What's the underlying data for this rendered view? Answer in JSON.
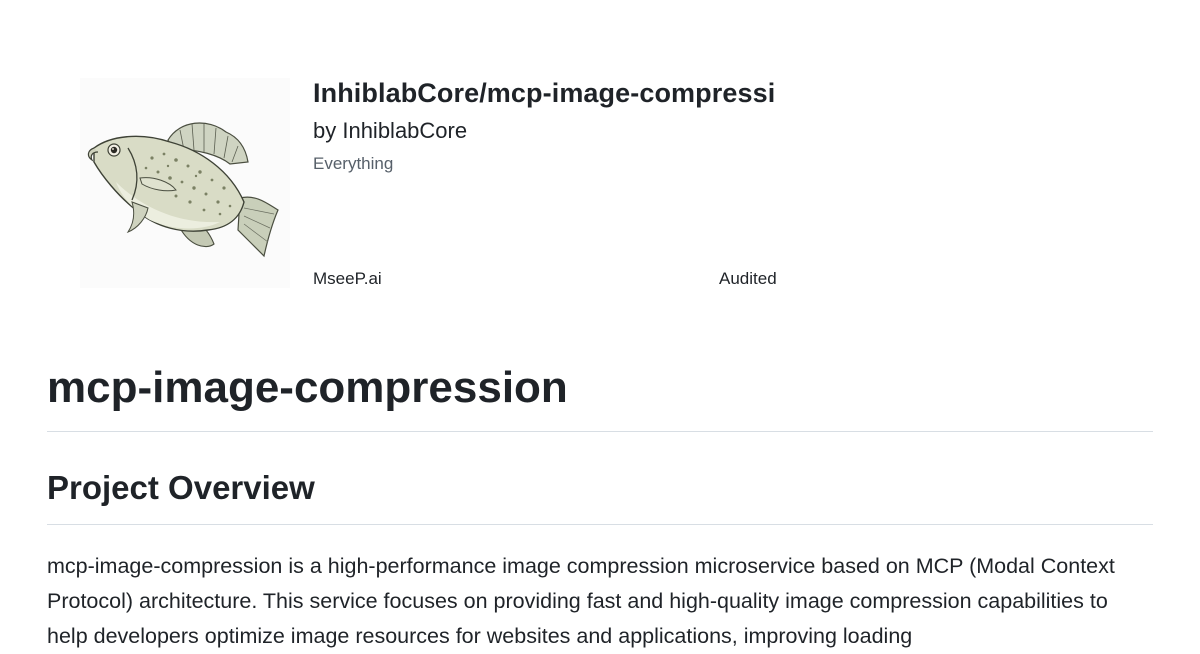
{
  "header": {
    "repo_title": "InhiblabCore/mcp-image-compressi",
    "author": "by InhiblabCore",
    "category": "Everything",
    "logo_icon": "crappie-fish-icon"
  },
  "badges": {
    "mseep": "MseeP.ai",
    "audited": "Audited"
  },
  "readme": {
    "title": "mcp-image-compression",
    "section_heading": "Project Overview",
    "paragraph": "mcp-image-compression is a high-performance image compression microservice based on MCP (Modal Context Protocol) architecture. This service focuses on providing fast and high-quality image compression capabilities to help developers optimize image resources for websites and applications, improving loading"
  },
  "colors": {
    "text": "#1f2328",
    "muted": "#57606a",
    "divider": "#d8dee4",
    "background": "#ffffff"
  }
}
